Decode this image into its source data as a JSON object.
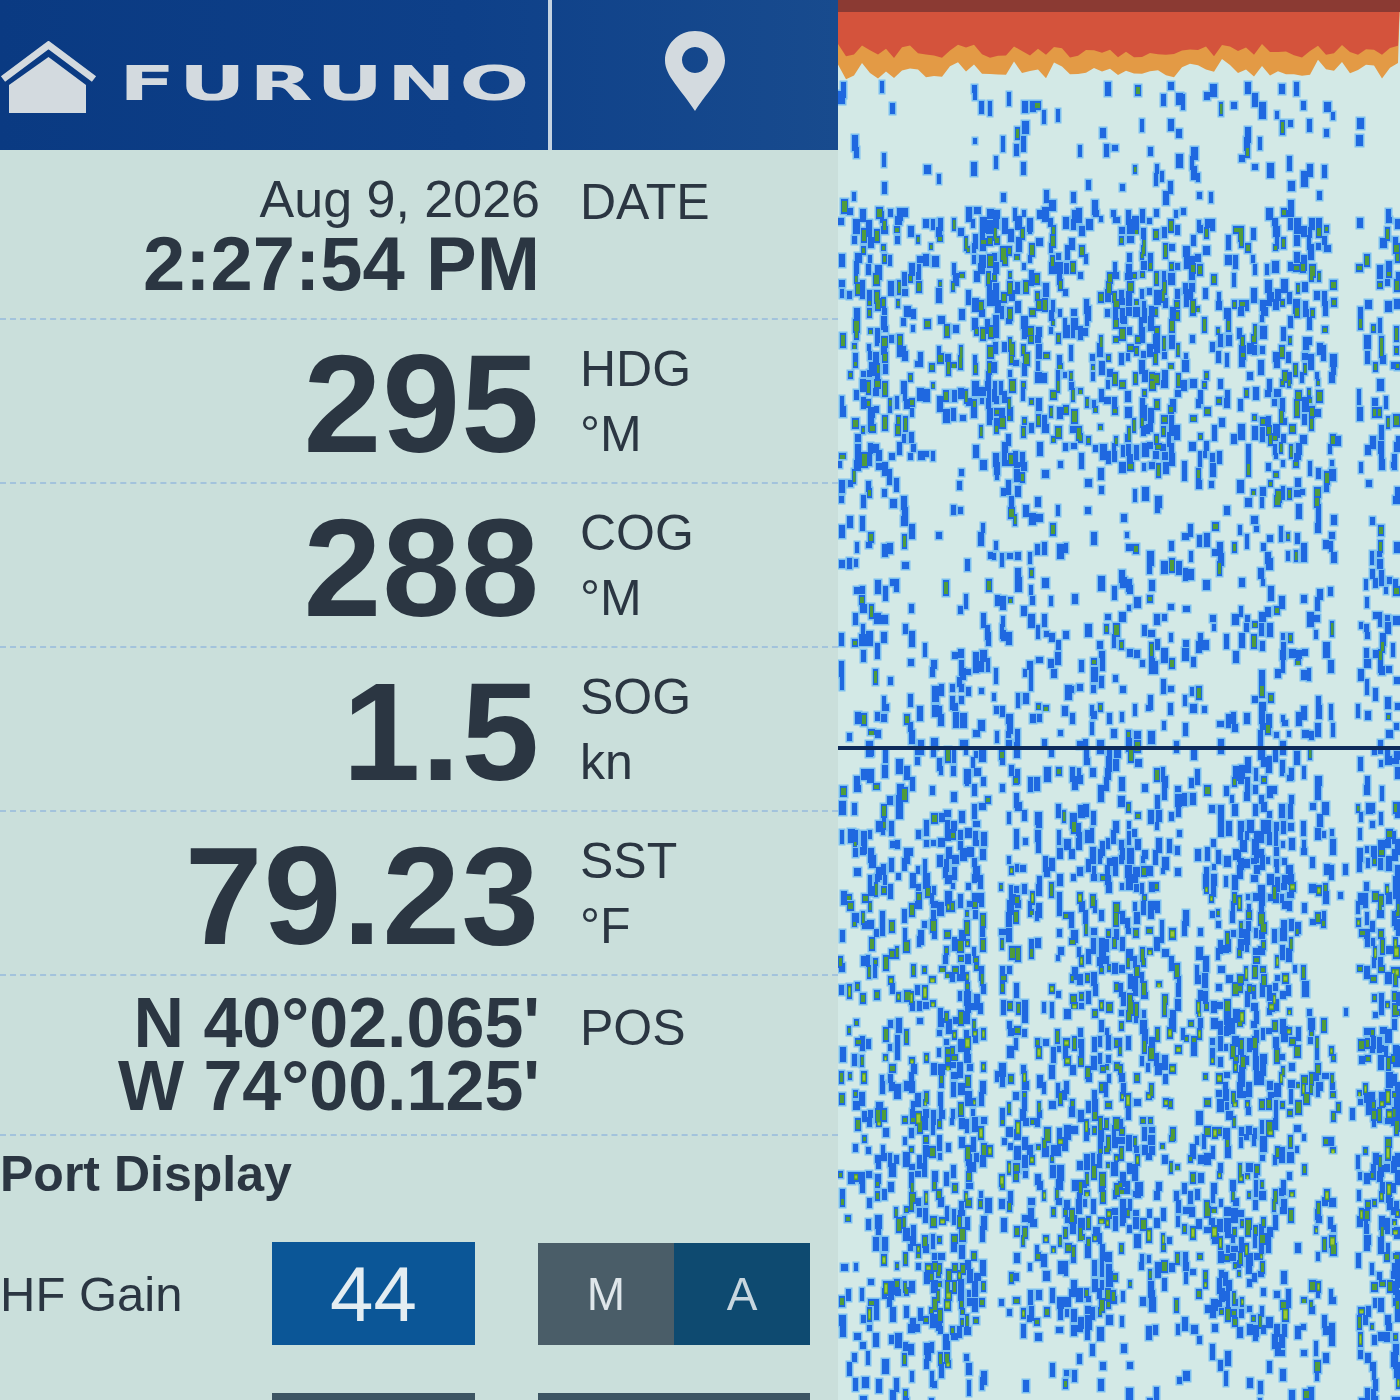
{
  "header": {
    "logo": "FURUNO"
  },
  "data_rows": [
    {
      "kind": "date",
      "values": [
        "Aug 9, 2026",
        "2:27:54 PM"
      ],
      "labels": [
        "DATE"
      ]
    },
    {
      "kind": "number",
      "values": [
        "295"
      ],
      "labels": [
        "HDG",
        "°M"
      ]
    },
    {
      "kind": "number",
      "values": [
        "288"
      ],
      "labels": [
        "COG",
        "°M"
      ]
    },
    {
      "kind": "number",
      "values": [
        "1.5"
      ],
      "labels": [
        "SOG",
        "kn"
      ]
    },
    {
      "kind": "number",
      "values": [
        "79.23"
      ],
      "labels": [
        "SST",
        "°F"
      ]
    },
    {
      "kind": "position",
      "values": [
        "N 40°02.065'",
        "W 74°00.125'"
      ],
      "labels": [
        "POS"
      ]
    }
  ],
  "port_display": {
    "title": "Port Display",
    "controls": [
      {
        "label": "HF Gain",
        "value": "44",
        "mode_options": [
          {
            "label": "M",
            "selected": false
          },
          {
            "label": "A",
            "selected": true
          }
        ]
      }
    ]
  }
}
